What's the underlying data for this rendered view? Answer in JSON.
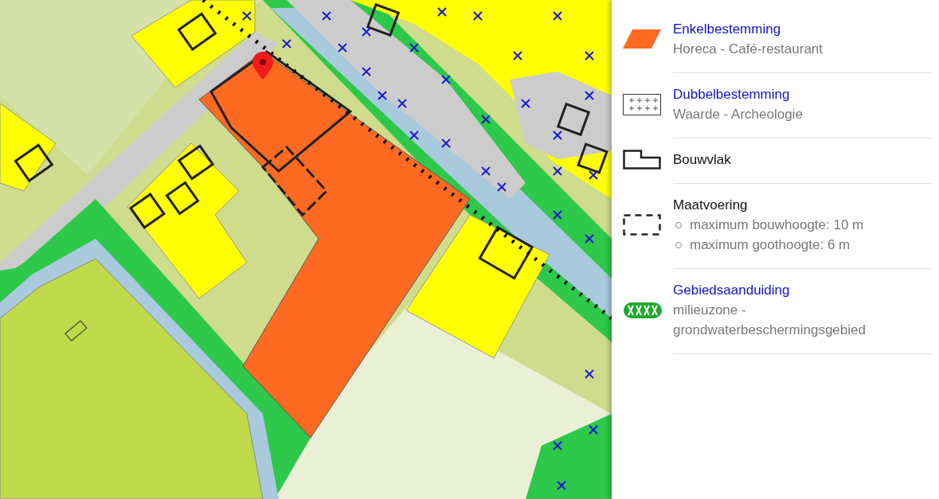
{
  "legend": {
    "items": [
      {
        "kind": "area",
        "linked": true,
        "title": "Enkelbestemming",
        "description": "Horeca - Café-restaurant"
      },
      {
        "kind": "crosses",
        "linked": true,
        "title": "Dubbelbestemming",
        "description": "Waarde - Archeologie"
      },
      {
        "kind": "outline",
        "linked": false,
        "title": "Bouwvlak"
      },
      {
        "kind": "dashed",
        "linked": false,
        "title": "Maatvoering",
        "details": [
          "maximum bouwhoogte: 10 m",
          "maximum goothoogte: 6 m"
        ]
      },
      {
        "kind": "zone",
        "linked": true,
        "title": "Gebiedsaanduiding",
        "description": "milieuzone - grondwaterbeschermingsgebied"
      }
    ]
  }
}
